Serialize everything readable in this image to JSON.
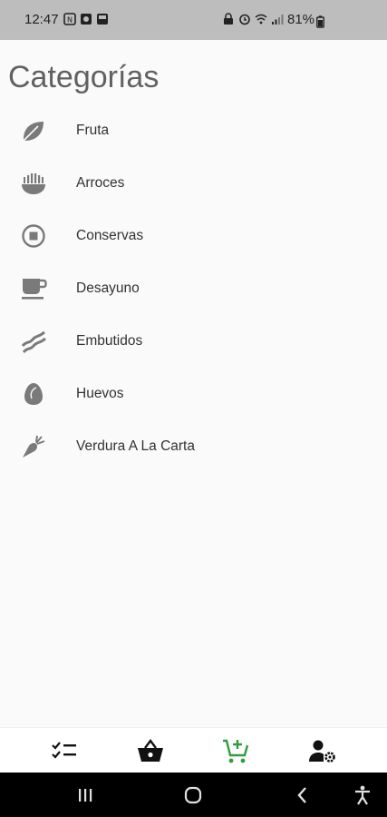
{
  "status_bar": {
    "time": "12:47",
    "battery": "81%"
  },
  "page": {
    "title": "Categorías"
  },
  "categories": [
    {
      "label": "Fruta",
      "icon": "leaf-icon"
    },
    {
      "label": "Arroces",
      "icon": "rice-bowl-icon"
    },
    {
      "label": "Conservas",
      "icon": "stop-circle-icon"
    },
    {
      "label": "Desayuno",
      "icon": "coffee-cup-icon"
    },
    {
      "label": "Embutidos",
      "icon": "bacon-icon"
    },
    {
      "label": "Huevos",
      "icon": "egg-icon"
    },
    {
      "label": "Verdura A La Carta",
      "icon": "carrot-icon"
    }
  ],
  "bottom_nav": {
    "items": [
      {
        "icon": "checklist-icon",
        "active": false
      },
      {
        "icon": "basket-icon",
        "active": false
      },
      {
        "icon": "add-to-cart-icon",
        "active": true
      },
      {
        "icon": "user-settings-icon",
        "active": false
      }
    ],
    "active_color": "#2e9e3e",
    "inactive_color": "#111111"
  },
  "colors": {
    "icon_gray": "#7a7a7a",
    "title_gray": "#616161"
  }
}
